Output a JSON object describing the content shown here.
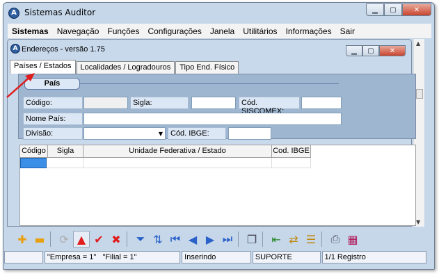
{
  "app": {
    "title": "Sistemas Auditor",
    "icon": "auditor-logo-icon",
    "icon_glyph": "A"
  },
  "menu": [
    "Sistemas",
    "Navegação",
    "Funções",
    "Configurações",
    "Janela",
    "Utilitários",
    "Informações",
    "Sair"
  ],
  "child_window": {
    "title": "Endereços - versão 1.75",
    "icon_glyph": "A"
  },
  "tabs": [
    "Países / Estados",
    "Localidades / Logradouros",
    "Tipo End. Físico"
  ],
  "section": {
    "title": "País"
  },
  "form": {
    "codigo_label": "Código:",
    "codigo_value": "",
    "sigla_label": "Sigla:",
    "sigla_value": "",
    "siscomex_label": "Cód. SISCOMEX:",
    "siscomex_value": "",
    "nome_label": "Nome País:",
    "nome_value": "",
    "divisao_label": "Divisão:",
    "divisao_value": "",
    "ibge_label": "Cód. IBGE:",
    "ibge_value": ""
  },
  "grid": {
    "columns": [
      "Código",
      "Sigla",
      "Unidade Federativa / Estado",
      "Cod. IBGE"
    ]
  },
  "toolbar": {
    "icons": [
      "add-icon",
      "remove-icon",
      "refresh-icon",
      "up-triangle-icon",
      "check-icon",
      "cancel-icon",
      "filter-icon",
      "sort-icon",
      "first-icon",
      "previous-icon",
      "next-icon",
      "last-icon",
      "copy-icon",
      "export-icon",
      "import-icon",
      "report-icon",
      "print-icon",
      "calendar-icon"
    ]
  },
  "status": {
    "empresa": "\"Empresa = 1\"",
    "filial": "\"Filial = 1\"",
    "mode": "Inserindo",
    "user": "SUPORTE",
    "records": "1/1 Registro"
  },
  "colors": {
    "frame": "#c6d7ea",
    "panel": "#9fb6d1",
    "selection": "#3b8fe6",
    "arrow": "#e01c1c"
  }
}
